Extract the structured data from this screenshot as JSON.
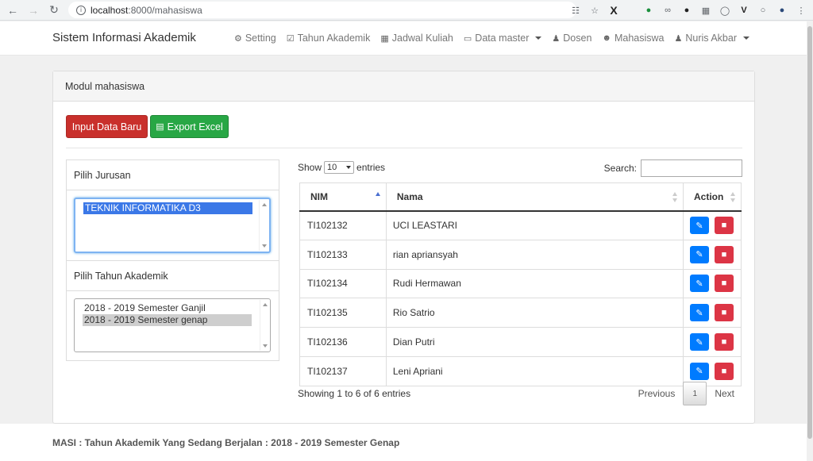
{
  "browser": {
    "url_host": "localhost",
    "url_path": ":8000/mahasiswa"
  },
  "navbar": {
    "brand": "Sistem Informasi Akademik",
    "links": [
      {
        "label": "Setting",
        "icon": "cogs-icon"
      },
      {
        "label": "Tahun Akademik",
        "icon": "calendar-check-icon"
      },
      {
        "label": "Jadwal Kuliah",
        "icon": "calendar-icon"
      },
      {
        "label": "Data master",
        "icon": "monitor-icon",
        "dropdown": true
      },
      {
        "label": "Dosen",
        "icon": "user-tie-icon"
      },
      {
        "label": "Mahasiswa",
        "icon": "users-icon"
      },
      {
        "label": "Nuris Akbar",
        "icon": "user-cog-icon",
        "dropdown": true
      }
    ]
  },
  "panel": {
    "heading": "Modul mahasiswa",
    "input_button": "Input Data Baru",
    "export_button": "Export Excel"
  },
  "filters": {
    "jurusan_label": "Pilih Jurusan",
    "jurusan_options": [
      "TEKNIK INFORMATIKA D3"
    ],
    "jurusan_selected": "TEKNIK INFORMATIKA D3",
    "tahun_label": "Pilih Tahun Akademik",
    "tahun_options": [
      "2018 - 2019 Semester Ganjil",
      "2018 - 2019 Semester genap"
    ],
    "tahun_selected": "2018 - 2019 Semester genap"
  },
  "table": {
    "show_label": "Show",
    "entries_value": "10",
    "entries_label": "entries",
    "search_label": "Search:",
    "search_value": "",
    "columns": [
      "NIM",
      "Nama",
      "Action"
    ],
    "rows": [
      {
        "nim": "TI102132",
        "nama": "UCI LEASTARI"
      },
      {
        "nim": "TI102133",
        "nama": "rian apriansyah"
      },
      {
        "nim": "TI102134",
        "nama": "Rudi Hermawan"
      },
      {
        "nim": "TI102135",
        "nama": "Rio Satrio"
      },
      {
        "nim": "TI102136",
        "nama": "Dian Putri"
      },
      {
        "nim": "TI102137",
        "nama": "Leni Apriani"
      }
    ],
    "info": "Showing 1 to 6 of 6 entries",
    "pagination": {
      "previous": "Previous",
      "current": "1",
      "next": "Next"
    }
  },
  "footer": {
    "text": "MASI : Tahun Akademik Yang Sedang Berjalan : 2018 - 2019 Semester Genap"
  },
  "colors": {
    "primary": "#007bff",
    "danger": "#dc3545",
    "input_button": "#c9302c",
    "export_button": "#28a745"
  }
}
